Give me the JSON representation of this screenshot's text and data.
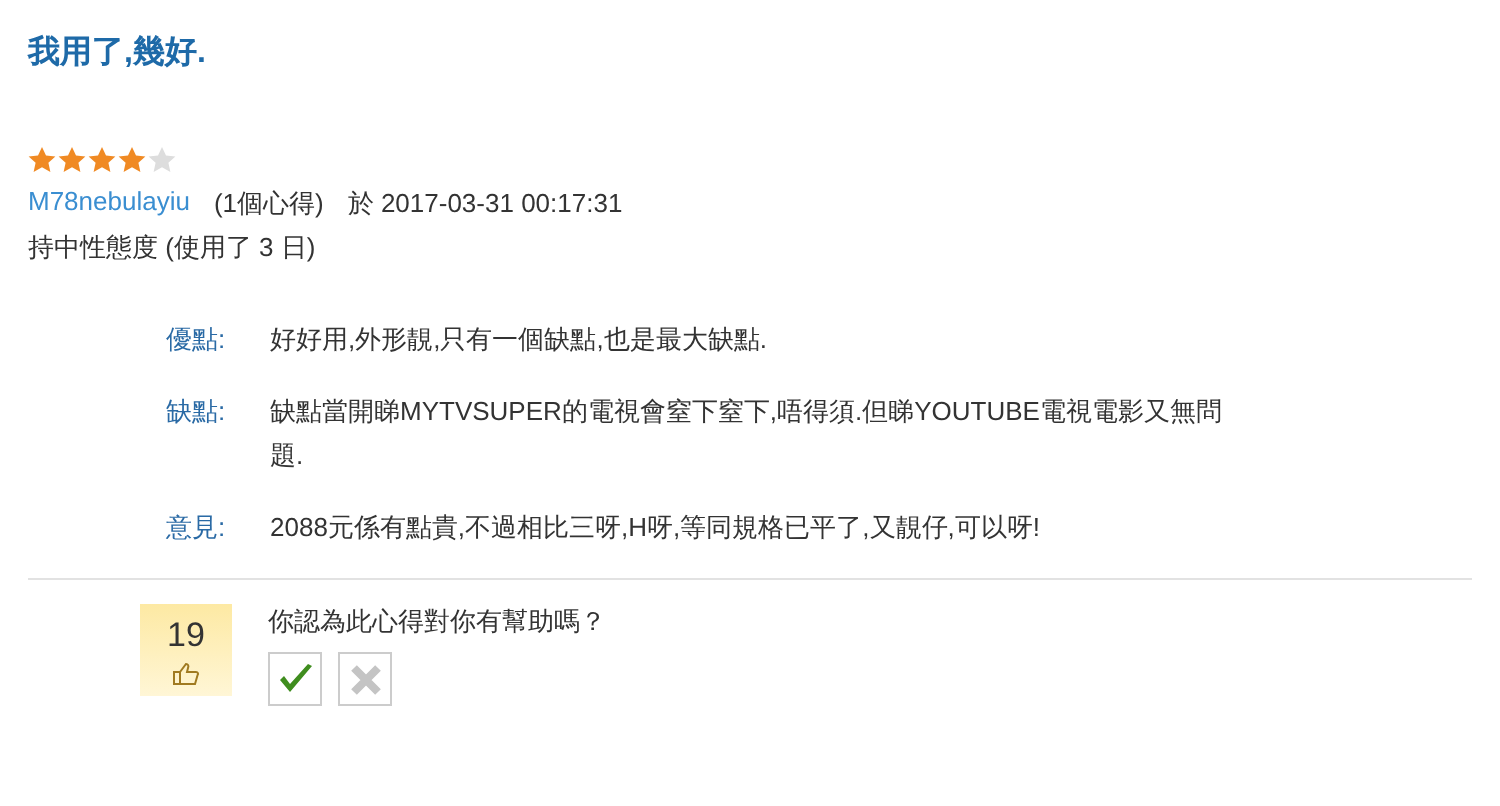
{
  "title": "我用了,幾好.",
  "rating": {
    "stars": 4
  },
  "author": {
    "name": "M78nebulayiu",
    "count": "(1個心得)",
    "posted": "於 2017-03-31 00:17:31"
  },
  "attitude": "持中性態度 (使用了 3 日)",
  "details": [
    {
      "label": "優點:",
      "text": "好好用,外形靚,只有一個缺點,也是最大缺點."
    },
    {
      "label": "缺點:",
      "text": "缺點當開睇MYTVSUPER的電視會窒下窒下,唔得須.但睇YOUTUBE電視電影又無問題."
    },
    {
      "label": "意見:",
      "text": "2088元係有點貴,不過相比三呀,H呀,等同規格已平了,又靚仔,可以呀!"
    }
  ],
  "helpful": {
    "count": "19",
    "question": "你認為此心得對你有幫助嗎？"
  }
}
